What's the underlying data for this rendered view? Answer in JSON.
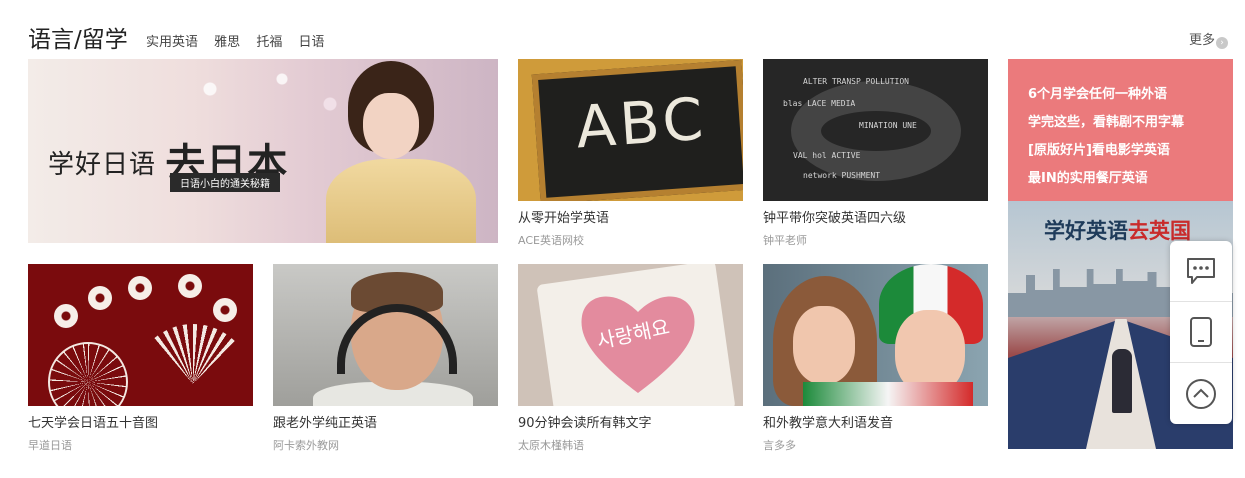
{
  "header": {
    "title": "语言/留学",
    "tabs": [
      "实用英语",
      "雅思",
      "托福",
      "日语"
    ],
    "more": "更多"
  },
  "banner": {
    "headline_prefix": "学好日语",
    "headline_brush": "去日本",
    "subtitle": "日语小白的通关秘籍"
  },
  "cards": [
    {
      "name": "从零开始学英语",
      "source": "ACE英语网校",
      "image_text": "ABC"
    },
    {
      "name": "钟平带你突破英语四六级",
      "source": "钟平老师"
    },
    {
      "name": "七天学会日语五十音图",
      "source": "早道日语"
    },
    {
      "name": "跟老外学纯正英语",
      "source": "阿卡索外教网"
    },
    {
      "name": "90分钟会读所有韩文字",
      "source": "太原木槿韩语",
      "image_text": "사랑해요"
    },
    {
      "name": "和外教学意大利语发音",
      "source": "言多多"
    }
  ],
  "promo": {
    "links": [
      "6个月学会任何一种外语",
      "学完这些，看韩剧不用字幕",
      "[原版好片]看电影学英语",
      "最IN的实用餐厅英语"
    ],
    "poster_title_a": "学好英语",
    "poster_title_b": "去英国"
  },
  "float_tools": [
    "chat-icon",
    "tablet-icon",
    "back-to-top-icon"
  ],
  "colors": {
    "promo_bg": "#eb7a7c",
    "title": "#222222",
    "source": "#999999"
  }
}
